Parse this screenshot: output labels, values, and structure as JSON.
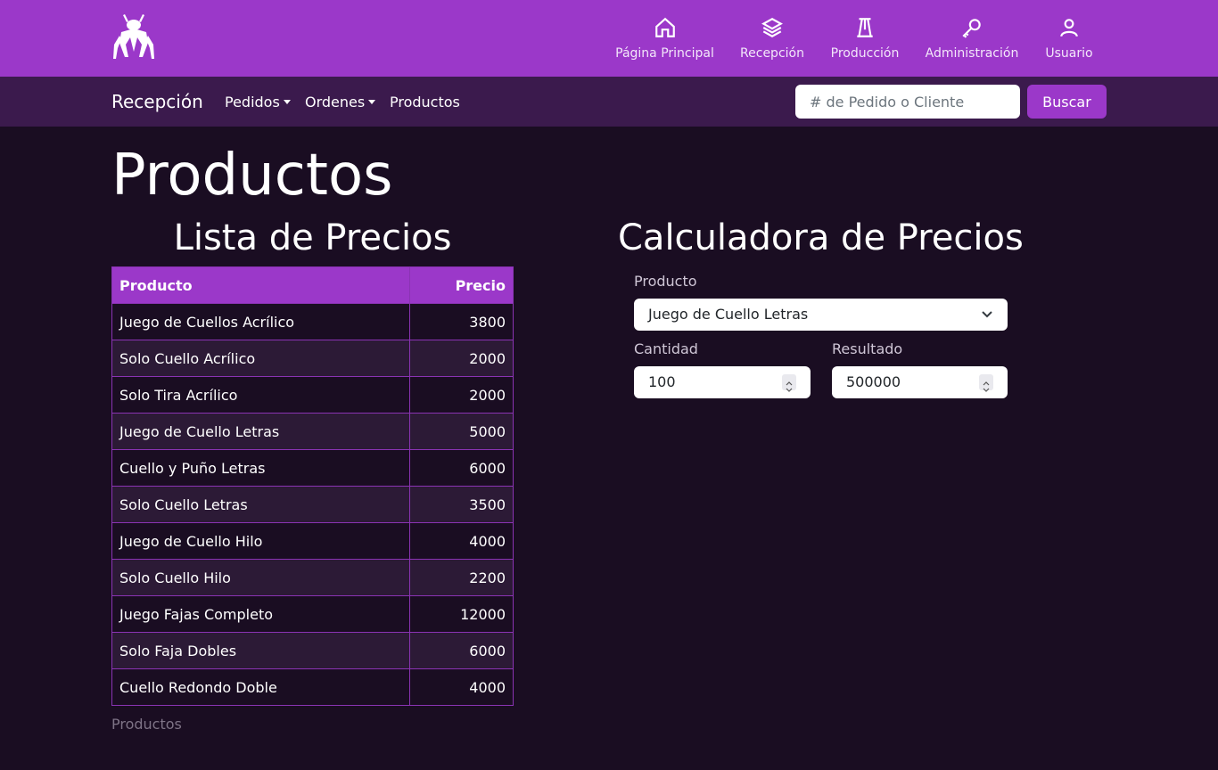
{
  "header": {
    "nav": [
      {
        "label": "Página Principal",
        "icon": "home-icon"
      },
      {
        "label": "Recepción",
        "icon": "layers-icon"
      },
      {
        "label": "Producción",
        "icon": "machine-icon"
      },
      {
        "label": "Administración",
        "icon": "key-icon"
      },
      {
        "label": "Usuario",
        "icon": "user-icon"
      }
    ]
  },
  "subnav": {
    "brand": "Recepción",
    "items": [
      "Pedidos",
      "Ordenes",
      "Productos"
    ],
    "search_placeholder": "# de Pedido o Cliente",
    "search_button": "Buscar"
  },
  "page": {
    "title": "Productos",
    "list_title": "Lista de Precios",
    "calc_title": "Calculadora de Precios",
    "footer_link": "Productos"
  },
  "table": {
    "headers": [
      "Producto",
      "Precio"
    ],
    "rows": [
      [
        "Juego de Cuellos Acrílico",
        "3800"
      ],
      [
        "Solo Cuello Acrílico",
        "2000"
      ],
      [
        "Solo Tira Acrílico",
        "2000"
      ],
      [
        "Juego de Cuello Letras",
        "5000"
      ],
      [
        "Cuello y Puño Letras",
        "6000"
      ],
      [
        "Solo Cuello Letras",
        "3500"
      ],
      [
        "Juego de Cuello Hilo",
        "4000"
      ],
      [
        "Solo Cuello Hilo",
        "2200"
      ],
      [
        "Juego Fajas Completo",
        "12000"
      ],
      [
        "Solo Faja Dobles",
        "6000"
      ],
      [
        "Cuello Redondo Doble",
        "4000"
      ]
    ]
  },
  "calculator": {
    "product_label": "Producto",
    "product_value": "Juego de Cuello Letras",
    "quantity_label": "Cantidad",
    "quantity_value": "100",
    "result_label": "Resultado",
    "result_value": "500000"
  },
  "colors": {
    "accent": "#9b38c9",
    "subbar": "#3b1a4d",
    "background": "#1a0d22"
  }
}
